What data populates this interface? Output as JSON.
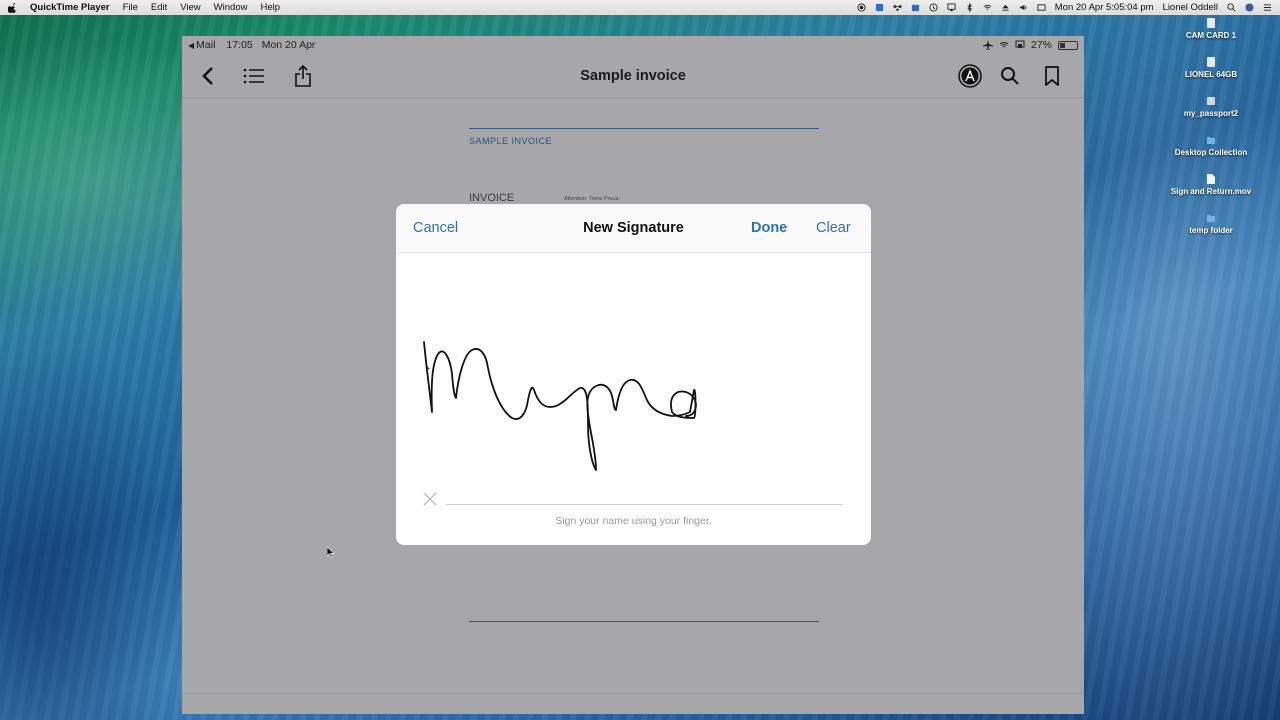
{
  "menubar": {
    "app_name": "QuickTime Player",
    "menus": [
      "File",
      "Edit",
      "View",
      "Window",
      "Help"
    ],
    "datetime": "Mon 20 Apr  5:05:04 pm",
    "user": "Lionel Oddell"
  },
  "desktop": {
    "items": [
      {
        "label": "CAM CARD 1"
      },
      {
        "label": "LIONEL 64GB"
      },
      {
        "label": "my_passport2"
      },
      {
        "label": "Desktop Collection"
      },
      {
        "label": "Sign and Return.mov"
      },
      {
        "label": "temp folder"
      }
    ]
  },
  "ipad": {
    "status": {
      "back_app": "Mail",
      "time": "17:05",
      "date": "Mon 20 Apr",
      "battery": "27%",
      "battery_level": 0.27
    },
    "nav": {
      "title": "Sample invoice"
    },
    "document": {
      "heading": "SAMPLE INVOICE",
      "invoice_label": "INVOICE",
      "attention": "Attention: Trenz Pruca"
    }
  },
  "modal": {
    "cancel_label": "Cancel",
    "title": "New Signature",
    "done_label": "Done",
    "clear_label": "Clear",
    "hint": "Sign your name using your finger."
  },
  "colors": {
    "accent": "#2f6fc0",
    "doc_rule": "#3a5c86"
  }
}
